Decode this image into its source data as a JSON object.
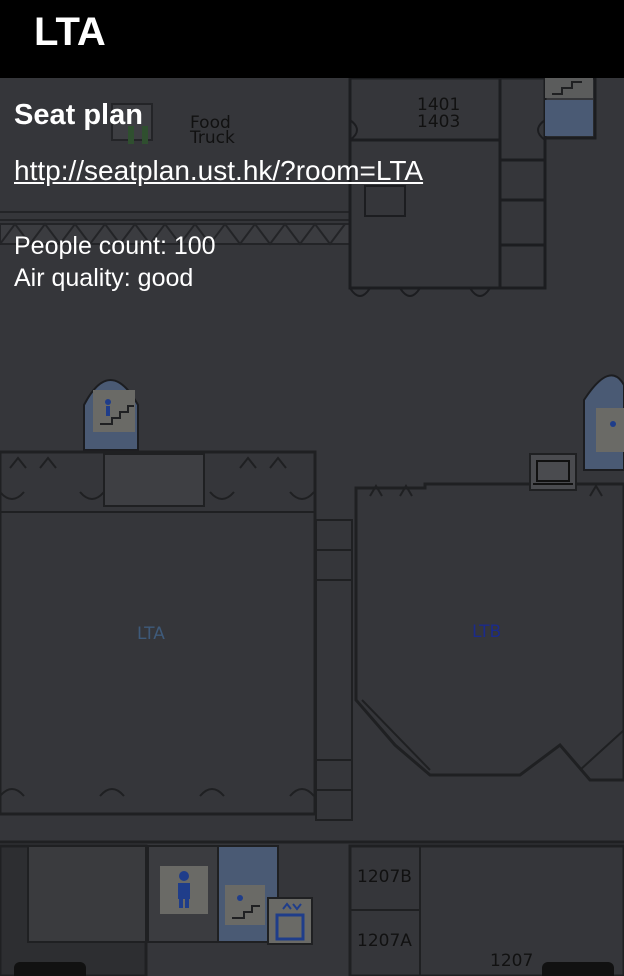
{
  "header": {
    "title": "LTA"
  },
  "info": {
    "seat_plan_heading": "Seat plan",
    "seat_plan_link": "http://seatplan.ust.hk/?room=LTA",
    "people_count_label": "People count:",
    "people_count": "100",
    "air_quality_label": "Air quality:",
    "air_quality": "good"
  },
  "map": {
    "labels": {
      "food_truck": [
        "Food",
        "Truck"
      ],
      "room_1401": "1401",
      "room_1403": "1403",
      "lta": "LTA",
      "ltb": "LTB",
      "room_1207b": "1207B",
      "room_1207a": "1207A",
      "room_1207": "1207"
    },
    "colors": {
      "background": "#35363a",
      "walls": "#1f2022",
      "lta_label": "#3e5a7a",
      "ltb_label": "#1b2a8a",
      "room_text": "#111111",
      "icon_tile": "#6a6a66",
      "icon_blue": "#1f3d8a"
    }
  }
}
